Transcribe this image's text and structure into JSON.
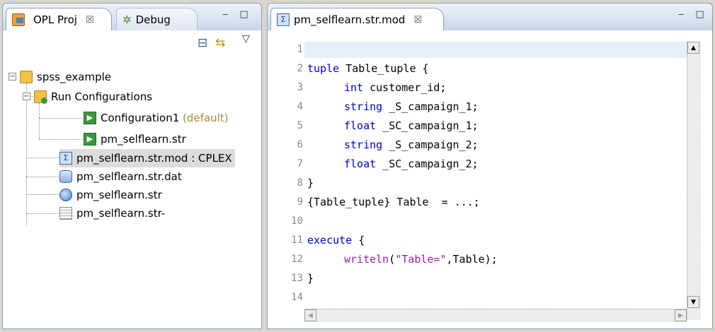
{
  "left_panel": {
    "tabs": [
      {
        "label": "OPL Proj",
        "close": "☒"
      },
      {
        "label": "Debug"
      }
    ],
    "window_controls": "‒ □",
    "toolbar": {
      "collapse_all": "⊟",
      "link_editor": "⇆",
      "view_menu": "▽"
    },
    "tree": {
      "project": "spss_example",
      "run_configs_label": "Run Configurations",
      "config1_name": "Configuration1",
      "config1_suffix": " (default)",
      "config2": "pm_selflearn.str",
      "files": [
        "pm_selflearn.str.mod : CPLEX",
        "pm_selflearn.str.dat",
        "pm_selflearn.str",
        "pm_selflearn.str-"
      ]
    }
  },
  "editor": {
    "tab_label": "pm_selflearn.str.mod",
    "tab_close": "☒",
    "window_controls": "‒ □",
    "line_numbers": [
      "1",
      "2",
      "3",
      "4",
      "5",
      "6",
      "7",
      "8",
      "9",
      "10",
      "11",
      "12",
      "13",
      "14"
    ],
    "code": {
      "l2_kw": "tuple",
      "l2_rest": " Table_tuple {",
      "l3_kw": "int",
      "l3_rest": " customer_id;",
      "l4_kw": "string",
      "l4_rest": " _S_campaign_1;",
      "l5_kw": "float",
      "l5_rest": " _SC_campaign_1;",
      "l6_kw": "string",
      "l6_rest": " _S_campaign_2;",
      "l7_kw": "float",
      "l7_rest": " _SC_campaign_2;",
      "l8": "}",
      "l9": "{Table_tuple} Table  = ...;",
      "l11_kw": "execute",
      "l11_rest": " {",
      "l12_fn": "writeln",
      "l12_open": "(",
      "l12_str": "\"Table=\"",
      "l12_rest": ",Table);",
      "l13": "}"
    },
    "scroll": {
      "up": "▲",
      "down": "▼",
      "left": "◀",
      "right": "▶"
    }
  }
}
